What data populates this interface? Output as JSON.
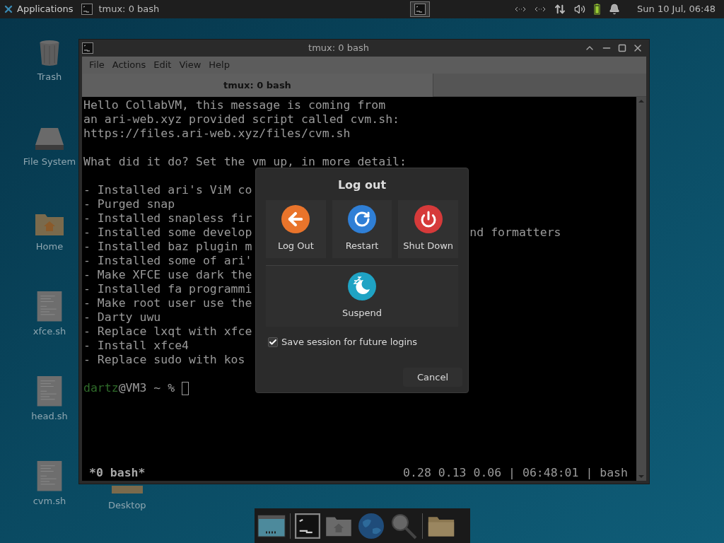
{
  "top_panel": {
    "apps_menu": "Applications",
    "tasks": [
      {
        "label": "tmux: 0 bash",
        "selected": false
      }
    ],
    "clock": "Sun 10 Jul, 06:48"
  },
  "desktop_icons": [
    {
      "label": "Trash",
      "kind": "trash"
    },
    {
      "label": "File System",
      "kind": "drive"
    },
    {
      "label": "Home",
      "kind": "home"
    },
    {
      "label": "xfce.sh",
      "kind": "script"
    },
    {
      "label": "head.sh",
      "kind": "script"
    },
    {
      "label": "cvm.sh",
      "kind": "script"
    }
  ],
  "desktop_folder": {
    "label": "Desktop"
  },
  "terminal": {
    "title": "tmux: 0 bash",
    "menu": [
      "File",
      "Actions",
      "Edit",
      "View",
      "Help"
    ],
    "tabs": [
      {
        "label": "tmux: 0 bash",
        "selected": true
      }
    ],
    "paragraphs": [
      [
        {
          "text": "Hello CollabVM, this message is coming from"
        },
        {
          "text": "an ari-web.xyz provided script called cvm.sh:"
        },
        {
          "text": "https://files.ari-web.xyz/files/cvm.sh"
        }
      ],
      [
        {
          "text": "What did it do? Set the vm up, in more detail:"
        }
      ],
      [
        {
          "text": "- Installed ari's ViM co"
        },
        {
          "text": "- Purged snap"
        },
        {
          "text": "- Installed snapless fir"
        },
        {
          "text": "- Installed some develop",
          "tail": "nd formatters"
        },
        {
          "text": "- Installed baz plugin m"
        },
        {
          "text": "- Installed some of ari'"
        },
        {
          "text": "- Make XFCE use dark the"
        },
        {
          "text": "- Installed fa programmi"
        },
        {
          "text": "- Make root user use the"
        },
        {
          "text": "- Darty uwu"
        },
        {
          "text": "- Replace lxqt with xfce"
        },
        {
          "text": "- Install xfce4"
        },
        {
          "text": "- Replace sudo with kos"
        }
      ]
    ],
    "prompt": {
      "user": "dartz",
      "rest": "@VM3 ~ %"
    },
    "status_left": "*0 bash*",
    "status_right": "0.28 0.13 0.06 | 06:48:01 | bash"
  },
  "dialog": {
    "title": "Log out",
    "actions": [
      {
        "label": "Log Out",
        "kind": "logout"
      },
      {
        "label": "Restart",
        "kind": "restart"
      },
      {
        "label": "Shut Down",
        "kind": "shutdown"
      }
    ],
    "secondary": [
      {
        "label": "Suspend",
        "kind": "suspend"
      }
    ],
    "save_session": {
      "label": "Save session for future logins",
      "checked": true
    },
    "cancel": "Cancel"
  },
  "dock": [
    {
      "kind": "windows"
    },
    {
      "kind": "separator"
    },
    {
      "kind": "terminal"
    },
    {
      "kind": "home"
    },
    {
      "kind": "browser"
    },
    {
      "kind": "search"
    },
    {
      "kind": "separator"
    },
    {
      "kind": "folder"
    }
  ]
}
